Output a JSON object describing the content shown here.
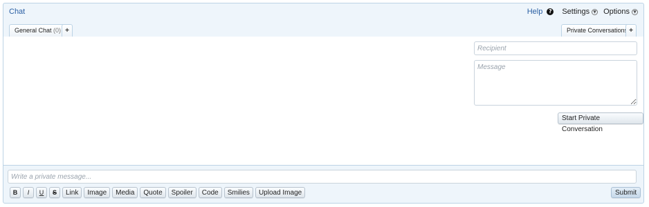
{
  "header": {
    "title": "Chat",
    "help_label": "Help",
    "help_icon": "question-circle-icon",
    "settings_label": "Settings",
    "options_label": "Options"
  },
  "tabs": {
    "general_label": "General Chat",
    "general_count": "(0)",
    "add_symbol": "+",
    "private_label": "Private Conversations"
  },
  "private_form": {
    "recipient_placeholder": "Recipient",
    "message_placeholder": "Message",
    "start_button": "Start Private Conversation"
  },
  "composer": {
    "placeholder": "Write a private message...",
    "toolbar": {
      "bold": "B",
      "italic": "I",
      "underline": "U",
      "strike": "S",
      "link": "Link",
      "image": "Image",
      "media": "Media",
      "quote": "Quote",
      "spoiler": "Spoiler",
      "code": "Code",
      "smilies": "Smilies",
      "upload_image": "Upload Image"
    },
    "submit": "Submit"
  },
  "colors": {
    "panel_bg": "#eef5fb",
    "border": "#bcd3e5",
    "link": "#2a5fa3"
  }
}
